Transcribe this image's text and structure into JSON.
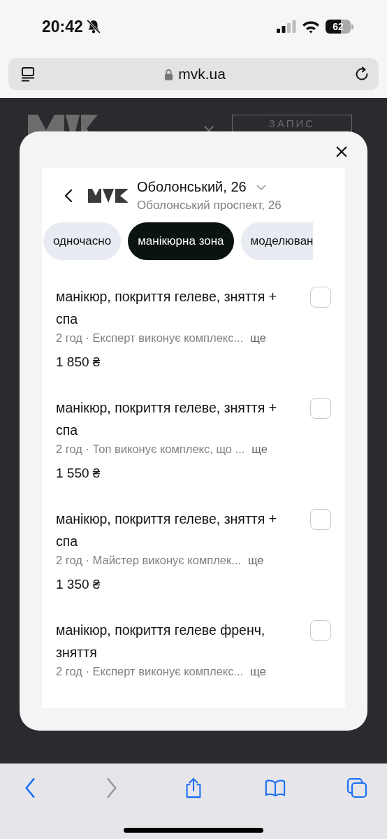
{
  "status_bar": {
    "time": "20:42",
    "silent": true,
    "battery": "62"
  },
  "address_bar": {
    "url": "mvk.ua"
  },
  "page_header": {
    "button": "ЗАПИС"
  },
  "modal": {
    "venue_title": "Оболонський, 26",
    "venue_address": "Оболонський проспект, 26",
    "chips": [
      {
        "label": "одночасно",
        "selected": false
      },
      {
        "label": "манікюрна зона",
        "selected": true
      },
      {
        "label": "моделюван",
        "selected": false
      }
    ],
    "services": [
      {
        "title": "манікюр, покриття гелеве, зняття + спа",
        "details": "2 год · Експерт виконує комплекс...",
        "more": "ще",
        "price": "1 850 ₴",
        "checked": false
      },
      {
        "title": "манікюр, покриття гелеве, зняття + спа",
        "details": "2 год · Топ виконує комплекс, що ...",
        "more": "ще",
        "price": "1 550 ₴",
        "checked": false
      },
      {
        "title": "манікюр, покриття гелеве, зняття + спа",
        "details": "2 год · Майстер виконує комплек...",
        "more": "ще",
        "price": "1 350 ₴",
        "checked": false
      },
      {
        "title": "манікюр, покриття гелеве френч, зняття",
        "details": "2 год · Експерт виконує комплекс...",
        "more": "ще",
        "checked": false
      }
    ]
  }
}
